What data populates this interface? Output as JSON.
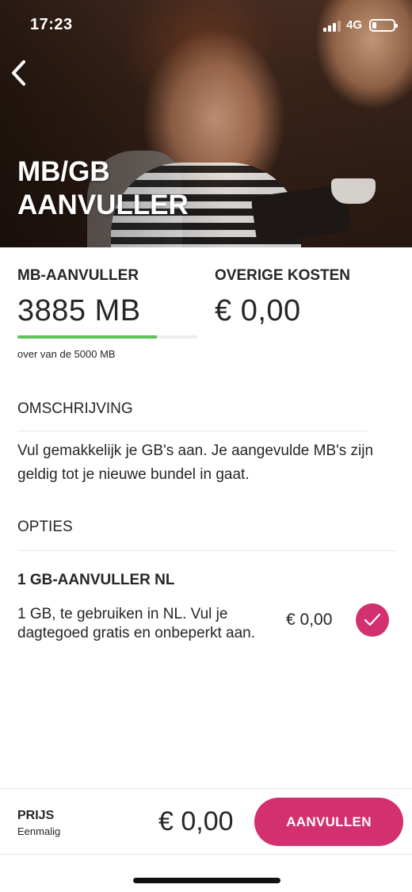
{
  "status_bar": {
    "time": "17:23",
    "network": "4G"
  },
  "header": {
    "title": "MB/GB AANVULLER"
  },
  "usage": {
    "mb_label": "MB-AANVULLER",
    "mb_value": "3885 MB",
    "remaining_fraction": 0.777,
    "mb_note": "over van de 5000 MB",
    "costs_label": "OVERIGE KOSTEN",
    "costs_value": "€ 0,00"
  },
  "description": {
    "heading": "OMSCHRIJVING",
    "text": "Vul gemakkelijk je GB's aan. Je aangevulde MB's zijn geldig tot je nieuwe bundel in gaat."
  },
  "options": {
    "heading": "OPTIES",
    "items": [
      {
        "title": "1 GB-AANVULLER NL",
        "description": "1 GB, te gebruiken in NL. Vul je dagtegoed gratis en onbeperkt aan.",
        "price": "€ 0,00",
        "selected": true
      }
    ]
  },
  "footer": {
    "price_label": "PRIJS",
    "price_sub": "Eenmalig",
    "price_value": "€ 0,00",
    "button_label": "AANVULLEN"
  },
  "colors": {
    "accent": "#d2306f",
    "progress": "#5cc157",
    "text": "#262626"
  },
  "icons": {
    "back": "chevron-left-icon",
    "selected": "checkmark-icon",
    "signal": "signal-bars-icon",
    "battery": "battery-icon"
  }
}
